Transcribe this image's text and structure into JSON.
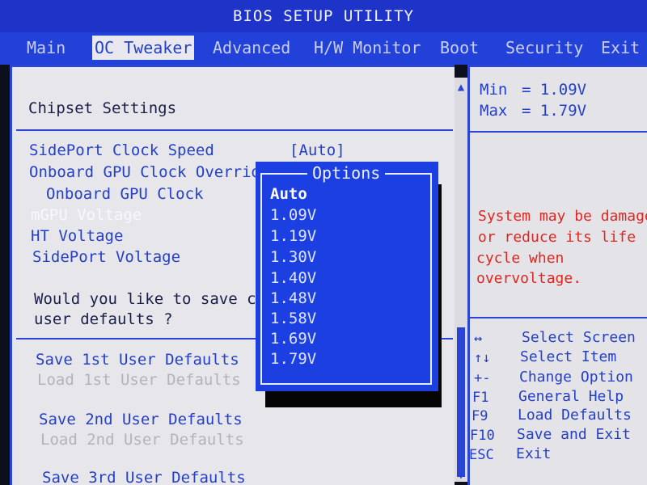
{
  "title": "BIOS SETUP UTILITY",
  "tabs": [
    {
      "label": "Main"
    },
    {
      "label": "OC Tweaker"
    },
    {
      "label": "Advanced"
    },
    {
      "label": "H/W Monitor"
    },
    {
      "label": "Boot"
    },
    {
      "label": "Security"
    },
    {
      "label": "Exit"
    }
  ],
  "active_tab": "OC Tweaker",
  "section_title": "Chipset Settings",
  "settings": [
    {
      "label": "SidePort Clock Speed",
      "value": "[Auto]"
    },
    {
      "label": "Onboard GPU Clock Override"
    },
    {
      "label": "Onboard GPU Clock"
    },
    {
      "label": "mGPU Voltage"
    },
    {
      "label": "HT Voltage"
    },
    {
      "label": "SidePort Voltage"
    }
  ],
  "save_prompt": {
    "line1": "Would you like to save curr",
    "line2": "user defaults ?"
  },
  "user_defaults": [
    {
      "label": "Save 1st User Defaults"
    },
    {
      "label": "Load 1st User Defaults"
    },
    {
      "label": "Save 2nd User Defaults"
    },
    {
      "label": "Load 2nd User Defaults"
    },
    {
      "label": "Save 3rd User Defaults"
    }
  ],
  "options_popup": {
    "title": "Options",
    "selected": "Auto",
    "options": [
      "Auto",
      "1.09V",
      "1.19V",
      "1.30V",
      "1.40V",
      "1.48V",
      "1.58V",
      "1.69V",
      "1.79V"
    ]
  },
  "help": {
    "min_label": "Min",
    "min_value": "= 1.09V",
    "max_label": "Max",
    "max_value": "= 1.79V",
    "warning": [
      "System may be damaged",
      "or reduce its life",
      "cycle  when",
      "overvoltage."
    ]
  },
  "keys": [
    {
      "key": "↔",
      "desc": "Select Screen"
    },
    {
      "key": "↑↓",
      "desc": "Select Item"
    },
    {
      "key": "+-",
      "desc": "Change Option"
    },
    {
      "key": "F1",
      "desc": "General Help"
    },
    {
      "key": "F9",
      "desc": "Load Defaults"
    },
    {
      "key": "F10",
      "desc": "Save and Exit"
    },
    {
      "key": "ESC",
      "desc": "Exit"
    }
  ],
  "colors": {
    "bios_blue": "#2241d8",
    "panel_grey": "#e7e6ea",
    "warning_red": "#e0261e",
    "popup_blue": "#1c3fe2"
  },
  "icons": {
    "scroll_up": "triangle-up",
    "scroll_down": "triangle-down"
  }
}
